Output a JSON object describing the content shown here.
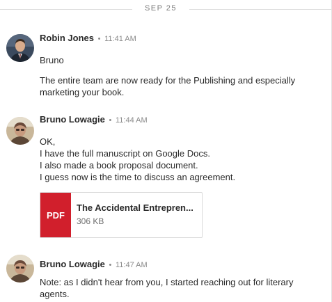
{
  "divider": {
    "date": "SEP 25"
  },
  "messages": [
    {
      "sender": "Robin Jones",
      "separator": "•",
      "time": "11:41 AM",
      "lines": [
        "Bruno",
        "The entire team are now ready for the Publishing and especially",
        "marketing your book."
      ]
    },
    {
      "sender": "Bruno Lowagie",
      "separator": "•",
      "time": "11:44 AM",
      "lines": [
        "OK,",
        "I have the full manuscript on Google Docs.",
        "I also made a book proposal document.",
        "I guess now is the time to discuss an agreement."
      ],
      "attachment": {
        "type_label": "PDF",
        "name": "The Accidental Entrepren...",
        "size": "306 KB"
      }
    },
    {
      "sender": "Bruno Lowagie",
      "separator": "•",
      "time": "11:47 AM",
      "lines": [
        "Note: as I didn't hear from you, I started reaching out for literary",
        "agents."
      ]
    }
  ]
}
